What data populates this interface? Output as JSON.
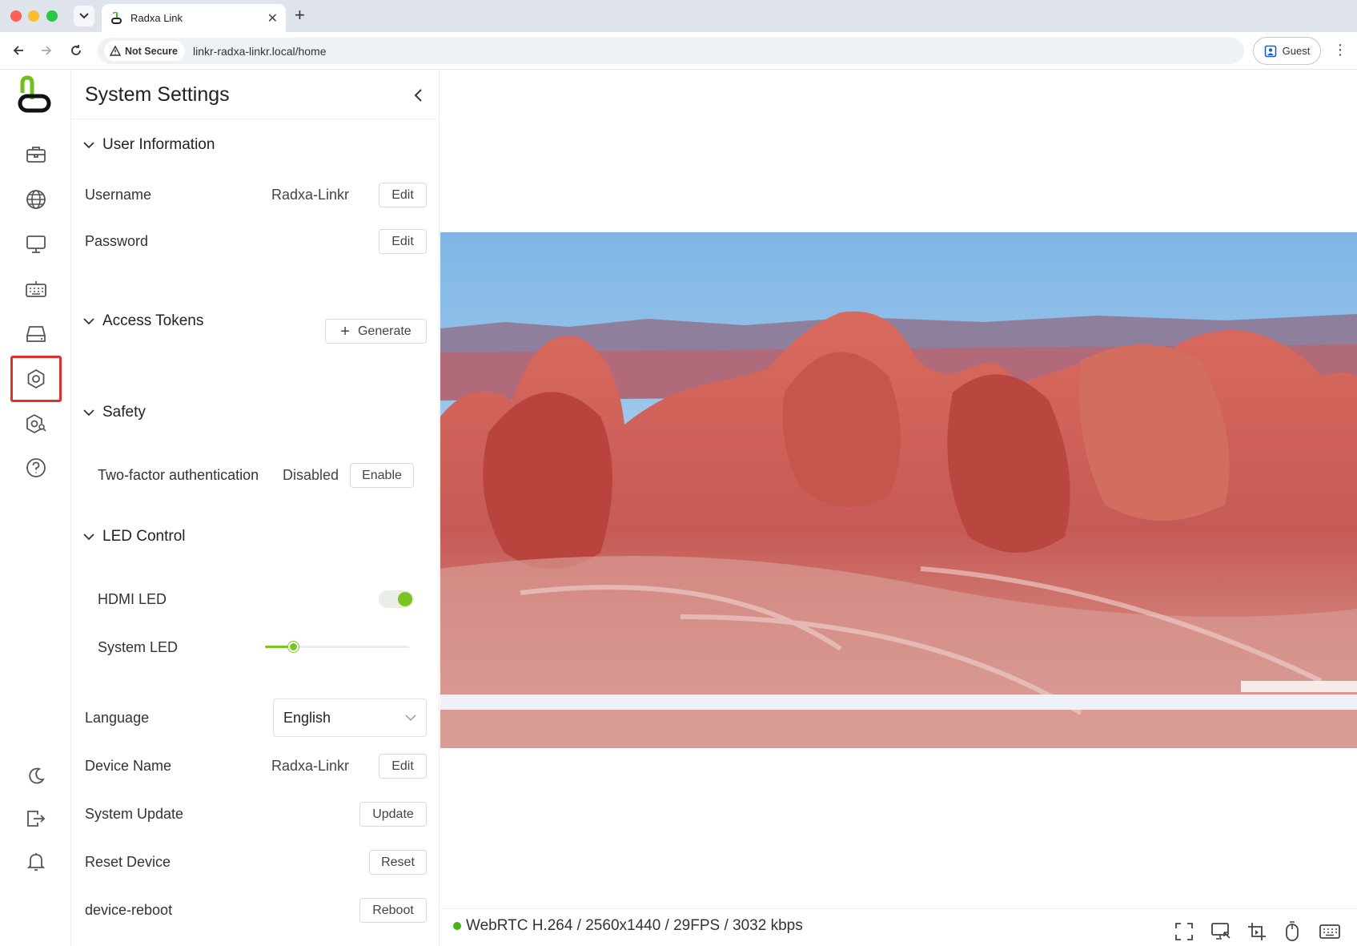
{
  "browser": {
    "tab_title": "Radxa Link",
    "not_secure": "Not Secure",
    "url": "linkr-radxa-linkr.local/home",
    "profile": "Guest"
  },
  "rail": {
    "items": [
      {
        "icon": "toolbox-icon"
      },
      {
        "icon": "globe-icon"
      },
      {
        "icon": "monitor-icon"
      },
      {
        "icon": "keyboard-icon"
      },
      {
        "icon": "drive-icon"
      },
      {
        "icon": "settings-icon",
        "active": true
      },
      {
        "icon": "settings-search-icon"
      },
      {
        "icon": "help-icon"
      }
    ],
    "bottom": [
      "moon-icon",
      "logout-icon",
      "bell-icon"
    ]
  },
  "settings": {
    "title": "System Settings",
    "user_info": {
      "header": "User Information",
      "username_label": "Username",
      "username_value": "Radxa-Linkr",
      "username_button": "Edit",
      "password_label": "Password",
      "password_button": "Edit"
    },
    "tokens": {
      "header": "Access Tokens",
      "generate_button": "Generate"
    },
    "safety": {
      "header": "Safety",
      "tfa_label": "Two-factor authentication",
      "tfa_value": "Disabled",
      "tfa_button": "Enable"
    },
    "led": {
      "header": "LED Control",
      "hdmi_label": "HDMI LED",
      "hdmi_on": true,
      "system_label": "System LED",
      "system_level": 0.2
    },
    "language": {
      "label": "Language",
      "value": "English"
    },
    "device_name": {
      "label": "Device Name",
      "value": "Radxa-Linkr",
      "button": "Edit"
    },
    "system_update": {
      "label": "System Update",
      "button": "Update"
    },
    "reset": {
      "label": "Reset Device",
      "button": "Reset"
    },
    "reboot": {
      "label": "device-reboot",
      "button": "Reboot"
    }
  },
  "viewer": {
    "status": "WebRTC H.264 / 2560x1440 / 29FPS / 3032 kbps",
    "status_color": "#49b21c",
    "controls": [
      "fullscreen-icon",
      "screen-icon",
      "crop-icon",
      "mouse-icon",
      "keyboard-icon"
    ]
  },
  "colors": {
    "accent": "#7cc520",
    "highlight": "#e0302a"
  }
}
